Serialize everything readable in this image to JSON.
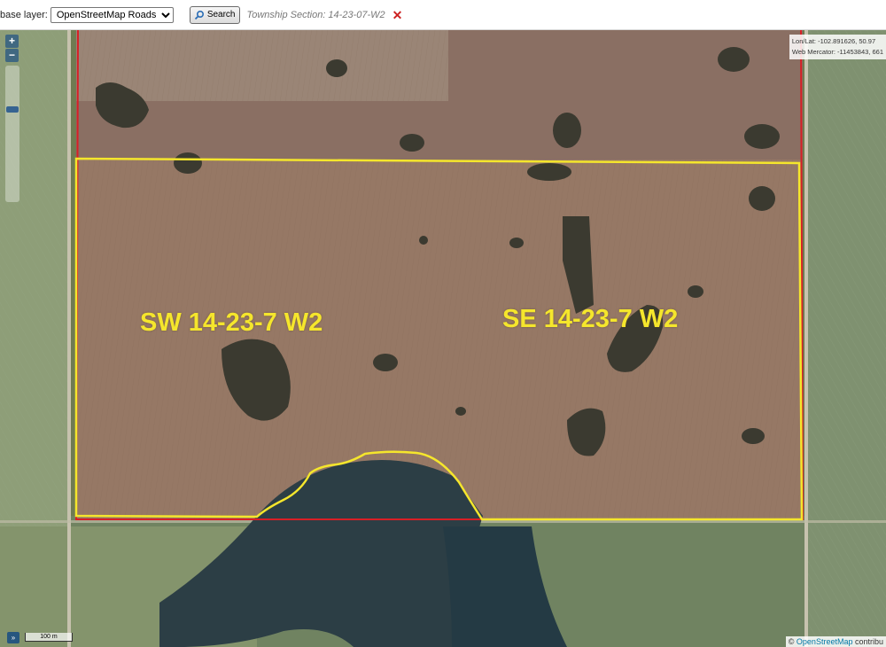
{
  "toolbar": {
    "base_layer_label": "base layer:",
    "base_layer_selected": "OpenStreetMap Roads",
    "search_label": "Search",
    "section_text": "Township Section: 14-23-07-W2"
  },
  "map": {
    "coords_lonlat": "Lon/Lat: -102.891626, 50.97",
    "coords_mercator": "Web Mercator: -11453843, 661",
    "scale_label": "100 m",
    "attribution_symbol": "©",
    "attribution_link": "OpenStreetMap",
    "attribution_suffix": " contribu",
    "labels": {
      "sw": "SW 14-23-7 W2",
      "se": "SE 14-23-7 W2"
    },
    "colors": {
      "parcel_outline": "#f5e62c",
      "section_boundary": "#d81f26",
      "label": "#f5e62c"
    },
    "icons": {
      "zoom_in": "+",
      "zoom_out": "−",
      "expand": "»",
      "clear": "✕"
    }
  }
}
